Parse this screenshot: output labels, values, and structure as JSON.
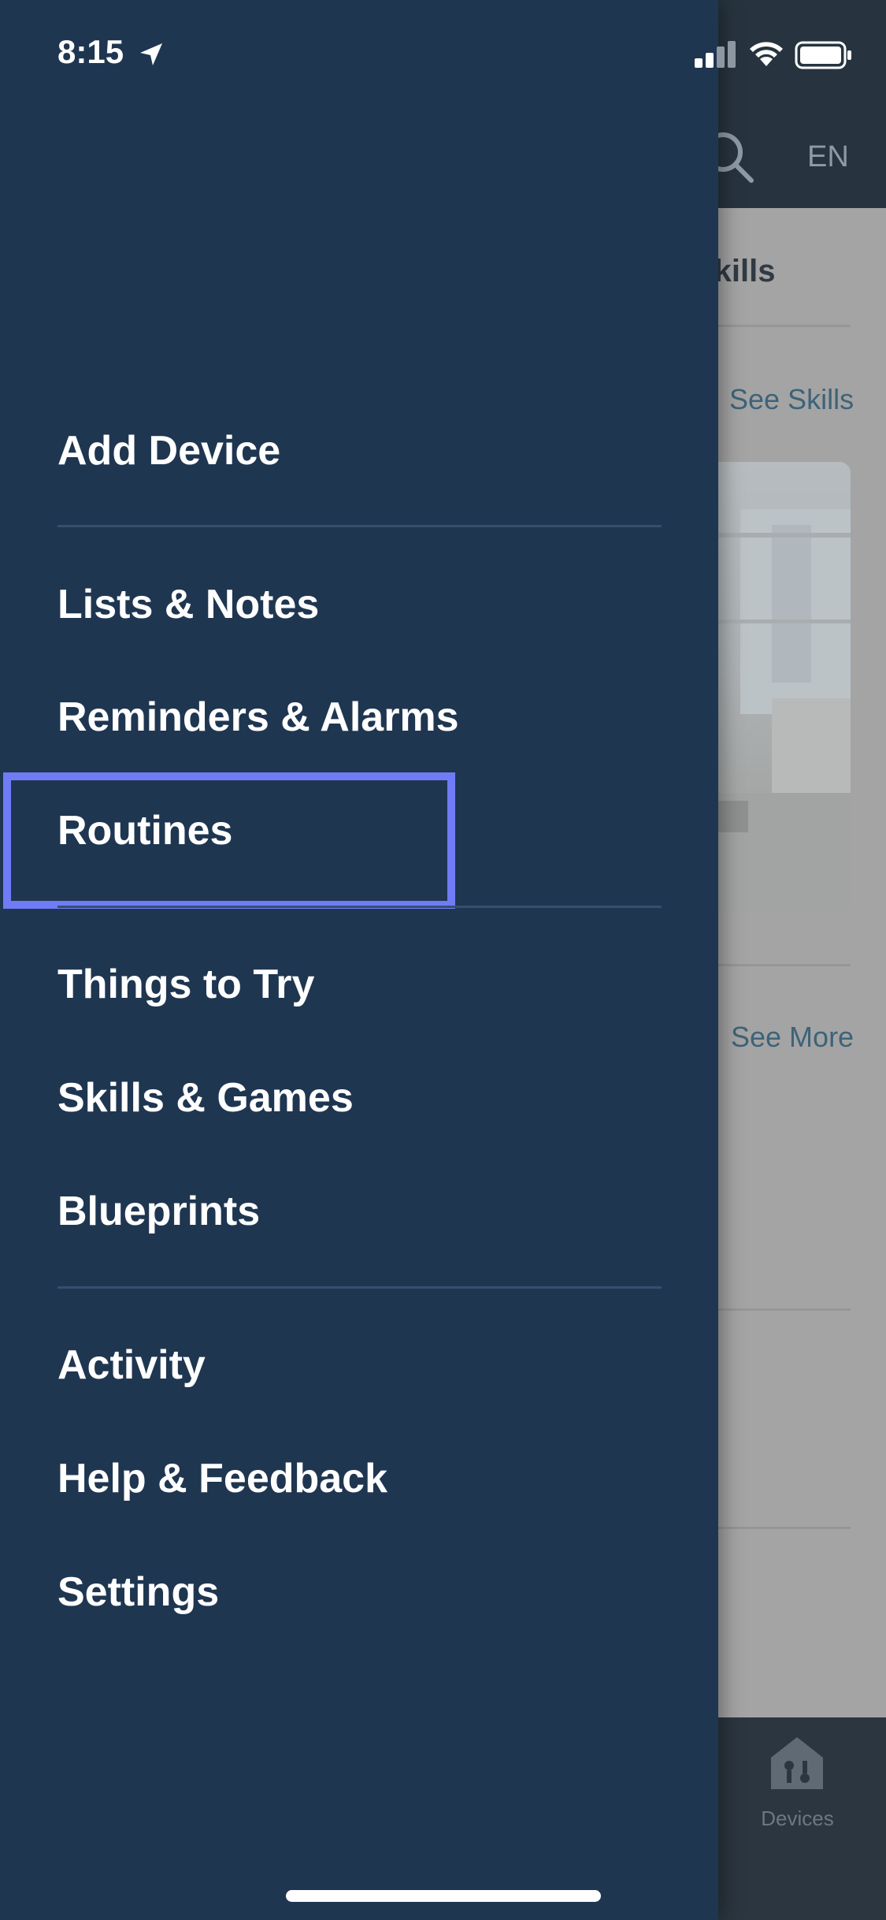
{
  "status_bar": {
    "time": "8:15"
  },
  "background_app": {
    "language": "EN",
    "section_title": "Skills",
    "see_skills": "See Skills",
    "see_more": "See More",
    "tab_devices": "Devices"
  },
  "drawer": {
    "groups": [
      {
        "items": [
          "Add Device"
        ]
      },
      {
        "items": [
          "Lists & Notes",
          "Reminders & Alarms",
          "Routines"
        ]
      },
      {
        "items": [
          "Things to Try",
          "Skills & Games",
          "Blueprints"
        ]
      },
      {
        "items": [
          "Activity",
          "Help & Feedback",
          "Settings"
        ]
      }
    ],
    "highlighted_item": "Routines"
  },
  "colors": {
    "drawer_bg": "#1f3651",
    "highlight": "#6f7cf6",
    "menu_text": "#ffffff"
  },
  "icons": [
    "location-arrow-icon",
    "signal-icon",
    "wifi-icon",
    "battery-icon",
    "search-icon",
    "devices-icon"
  ]
}
